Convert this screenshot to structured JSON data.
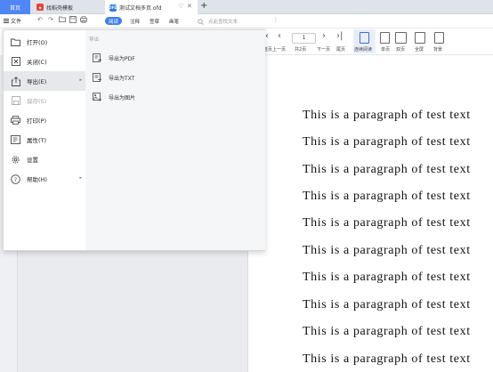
{
  "tabs": {
    "home": "首页",
    "template": "找稻壳模板",
    "document": "测试文档多页.ofd"
  },
  "menubar": {
    "file": "文件",
    "read": "阅读",
    "annotate": "注释",
    "sign": "签章",
    "draw": "画笔",
    "search_placeholder": "点此查找文本",
    "more": "⋮"
  },
  "readbar": {
    "page_number": "1",
    "first": "首页",
    "prev": "上一页",
    "all_pages": "共2页",
    "next": "下一页",
    "last": "尾页",
    "continuous": "连续阅读",
    "single": "单页",
    "double": "双页",
    "fullscreen": "全屏",
    "background": "背景"
  },
  "file_menu": {
    "items": [
      {
        "label": "打开(O)",
        "icon": "folder-icon"
      },
      {
        "label": "关闭(C)",
        "icon": "close-box-icon"
      },
      {
        "label": "导出(E)",
        "icon": "export-icon"
      },
      {
        "label": "保存(S)",
        "icon": "save-icon"
      },
      {
        "label": "打印(P)",
        "icon": "printer-icon"
      },
      {
        "label": "属性(T)",
        "icon": "properties-icon"
      },
      {
        "label": "设置",
        "icon": "gear-icon"
      },
      {
        "label": "帮助(H)",
        "icon": "help-icon"
      }
    ],
    "submenu_title": "导出",
    "submenu": [
      {
        "label": "导出为PDF",
        "icon": "pdf-export-icon"
      },
      {
        "label": "导出为TXT",
        "icon": "txt-export-icon"
      },
      {
        "label": "导出为图片",
        "icon": "image-export-icon"
      }
    ]
  },
  "document": {
    "lines": [
      "This is a paragraph of test text",
      "This is a paragraph of test text",
      "This is a paragraph of test text",
      "This is a paragraph of test text",
      "This is a paragraph of test text",
      "This is a paragraph of test text",
      "This is a paragraph of test text",
      "This is a paragraph of test text",
      "This is a paragraph of test text",
      "This is a paragraph of test text"
    ]
  },
  "colors": {
    "accent": "#3c7ff1",
    "home_tab": "#4f86f7"
  }
}
